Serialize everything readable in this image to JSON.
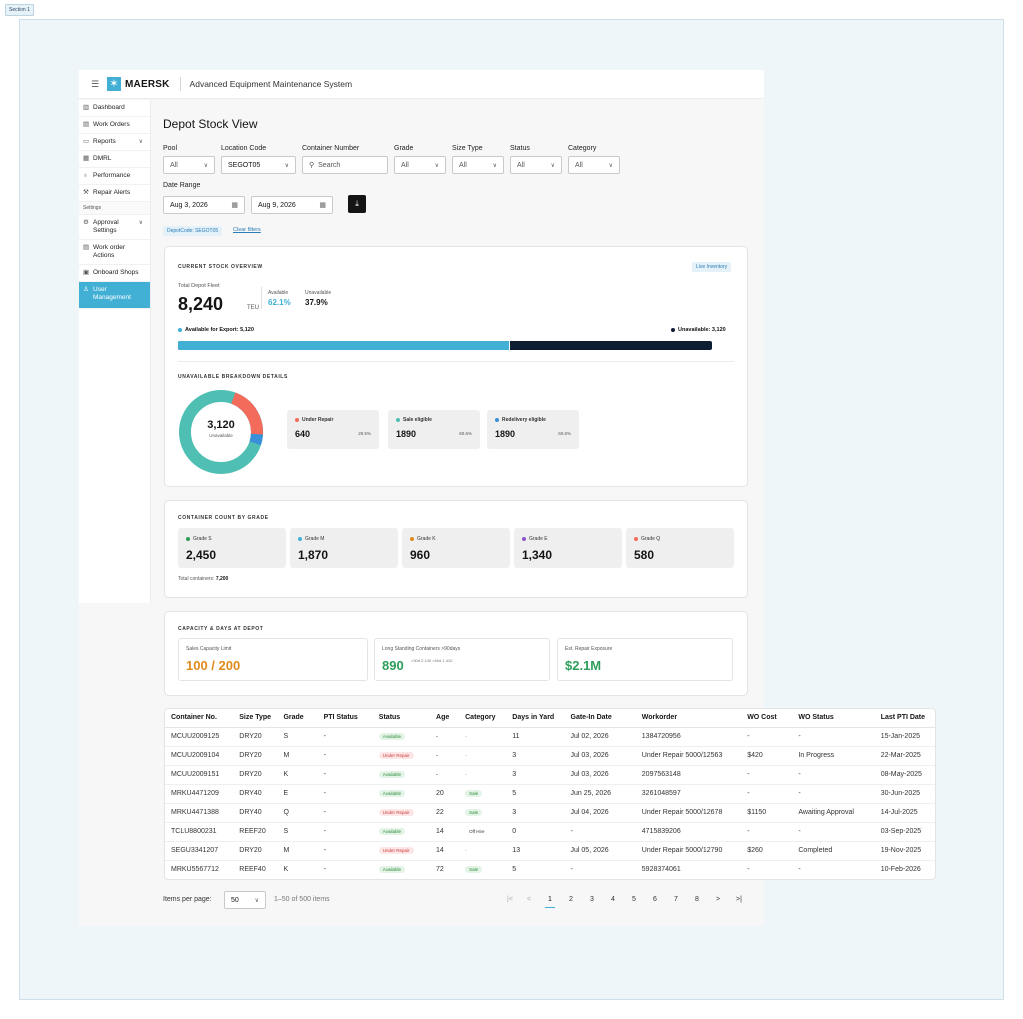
{
  "section_tag": "Section 1",
  "header": {
    "logo_text": "MAERSK",
    "app_title": "Advanced Equipment Maintenance System"
  },
  "sidebar": {
    "items": [
      {
        "label": "Dashboard",
        "icon": "chart-icon"
      },
      {
        "label": "Work Orders",
        "icon": "clipboard-icon"
      },
      {
        "label": "Reports",
        "icon": "folder-icon",
        "expandable": true
      },
      {
        "label": "DMRL",
        "icon": "keyboard-icon"
      },
      {
        "label": "Performance",
        "icon": "medal-icon"
      },
      {
        "label": "Repair Alerts",
        "icon": "wrench-icon"
      }
    ],
    "settings_label": "Settings",
    "settings_items": [
      {
        "label": "Approval Settings",
        "icon": "gear-icon",
        "expandable": true
      },
      {
        "label": "Work order Actions",
        "icon": "clipboard-icon"
      },
      {
        "label": "Onboard Shops",
        "icon": "store-icon"
      },
      {
        "label": "User Management",
        "icon": "user-icon",
        "active": true
      }
    ]
  },
  "page": {
    "title": "Depot Stock View"
  },
  "filters": {
    "pool_label": "Pool",
    "pool_value": "All",
    "location_label": "Location Code",
    "location_value": "SEGOT05",
    "container_label": "Container Number",
    "container_placeholder": "Search",
    "grade_label": "Grade",
    "grade_value": "All",
    "size_label": "Size Type",
    "size_value": "All",
    "status_label": "Status",
    "status_value": "All",
    "category_label": "Category",
    "category_value": "All",
    "date_label": "Date Range",
    "date_from": "Aug 3, 2026",
    "date_to": "Aug 9, 2026",
    "active_chip": "DepotCode: SEGOT05",
    "clear_label": "Clear filters"
  },
  "overview": {
    "heading": "CURRENT STOCK OVERVIEW",
    "live_badge": "Live Inventory",
    "total_label": "Total Depot Fleet",
    "total_value": "8,240",
    "total_unit": "TEU",
    "available_label": "Available",
    "available_pct": "62.1%",
    "unavailable_label": "Unavailable",
    "unavailable_pct": "37.9%",
    "export_legend": "Available for Export: 5,120",
    "unavail_legend": "Unavailable: 3,120",
    "bar_available_fraction": 0.621,
    "breakdown_heading": "UNAVAILABLE BREAKDOWN DETAILS",
    "donut_value": "3,120",
    "donut_label": "Unavailable",
    "breakdown": [
      {
        "name": "Under Repair",
        "value": "640",
        "pct": "20.5%",
        "color": "#f26b5b"
      },
      {
        "name": "Sale eligible",
        "value": "1890",
        "pct": "60.6%",
        "color": "#4fbfb4"
      },
      {
        "name": "Redelivery eligible",
        "value": "1890",
        "pct": "60.6%",
        "color": "#3a8fd9"
      }
    ]
  },
  "grades": {
    "heading": "CONTAINER COUNT BY GRADE",
    "items": [
      {
        "name": "Grade S",
        "value": "2,450",
        "color": "#2e9e5b"
      },
      {
        "name": "Grade M",
        "value": "1,870",
        "color": "#42b0d5"
      },
      {
        "name": "Grade K",
        "value": "960",
        "color": "#e08a1e"
      },
      {
        "name": "Grade E",
        "value": "1,340",
        "color": "#8a55c7"
      },
      {
        "name": "Grade Q",
        "value": "580",
        "color": "#f26b5b"
      }
    ],
    "total_label": "Total containers:",
    "total_value": "7,200"
  },
  "capacity": {
    "heading": "CAPACITY & DAYS AT DEPOT",
    "sales_label": "Sales Capacity Limit",
    "sales_value": "100 / 200",
    "long_label": "Long Standing Containers >90days",
    "long_value": "890",
    "long_sub": ">30d 2,140  >60d 1,410",
    "repair_label": "Est. Repair Exposure",
    "repair_value": "$2.1M"
  },
  "table": {
    "columns": [
      "Container No.",
      "Size Type",
      "Grade",
      "PTI Status",
      "Status",
      "Age",
      "Category",
      "Days in Yard",
      "Gate-In Date",
      "Workorder",
      "WO Cost",
      "WO Status",
      "Last PTI Date"
    ],
    "rows": [
      [
        "MCUU2009125",
        "DRY20",
        "S",
        "-",
        "Available",
        "-",
        "-",
        "11",
        "Jul 02, 2026",
        "1384720956",
        "-",
        "-",
        "15-Jan-2025"
      ],
      [
        "MCUU2009104",
        "DRY20",
        "M",
        "-",
        "Under Repair",
        "-",
        "-",
        "3",
        "Jul 03, 2026",
        "Under Repair 5000/12563",
        "$420",
        "In Progress",
        "22-Mar-2025"
      ],
      [
        "MCUU2009151",
        "DRY20",
        "K",
        "-",
        "Available",
        "-",
        "-",
        "3",
        "Jul 03, 2026",
        "2097563148",
        "-",
        "-",
        "08-May-2025"
      ],
      [
        "MRKU4471209",
        "DRY40",
        "E",
        "-",
        "Available",
        "20",
        "Sale",
        "5",
        "Jun 25, 2026",
        "3261048597",
        "-",
        "-",
        "30-Jun-2025"
      ],
      [
        "MRKU4471388",
        "DRY40",
        "Q",
        "-",
        "Under Repair",
        "22",
        "Sale",
        "3",
        "Jul 04, 2026",
        "Under Repair 5000/12678",
        "$1150",
        "Awaiting Approval",
        "14-Jul-2025"
      ],
      [
        "TCLU8800231",
        "REEF20",
        "S",
        "-",
        "Available",
        "14",
        "Off Hire",
        "0",
        "-",
        "4715839206",
        "-",
        "-",
        "03-Sep-2025"
      ],
      [
        "SEGU3341207",
        "DRY20",
        "M",
        "-",
        "Under Repair",
        "14",
        "-",
        "13",
        "Jul 05, 2026",
        "Under Repair 5000/12790",
        "$260",
        "Completed",
        "19-Nov-2025"
      ],
      [
        "MRKU5567712",
        "REEF40",
        "K",
        "-",
        "Available",
        "72",
        "Sale",
        "5",
        "-",
        "5928374061",
        "-",
        "-",
        "10-Feb-2026"
      ]
    ]
  },
  "pagination": {
    "items_per_page_label": "Items per page:",
    "per_page_value": "50",
    "range_text": "1–50 of 500 items",
    "pages": [
      "1",
      "2",
      "3",
      "4",
      "5",
      "6",
      "7",
      "8"
    ],
    "current_page": "1"
  }
}
